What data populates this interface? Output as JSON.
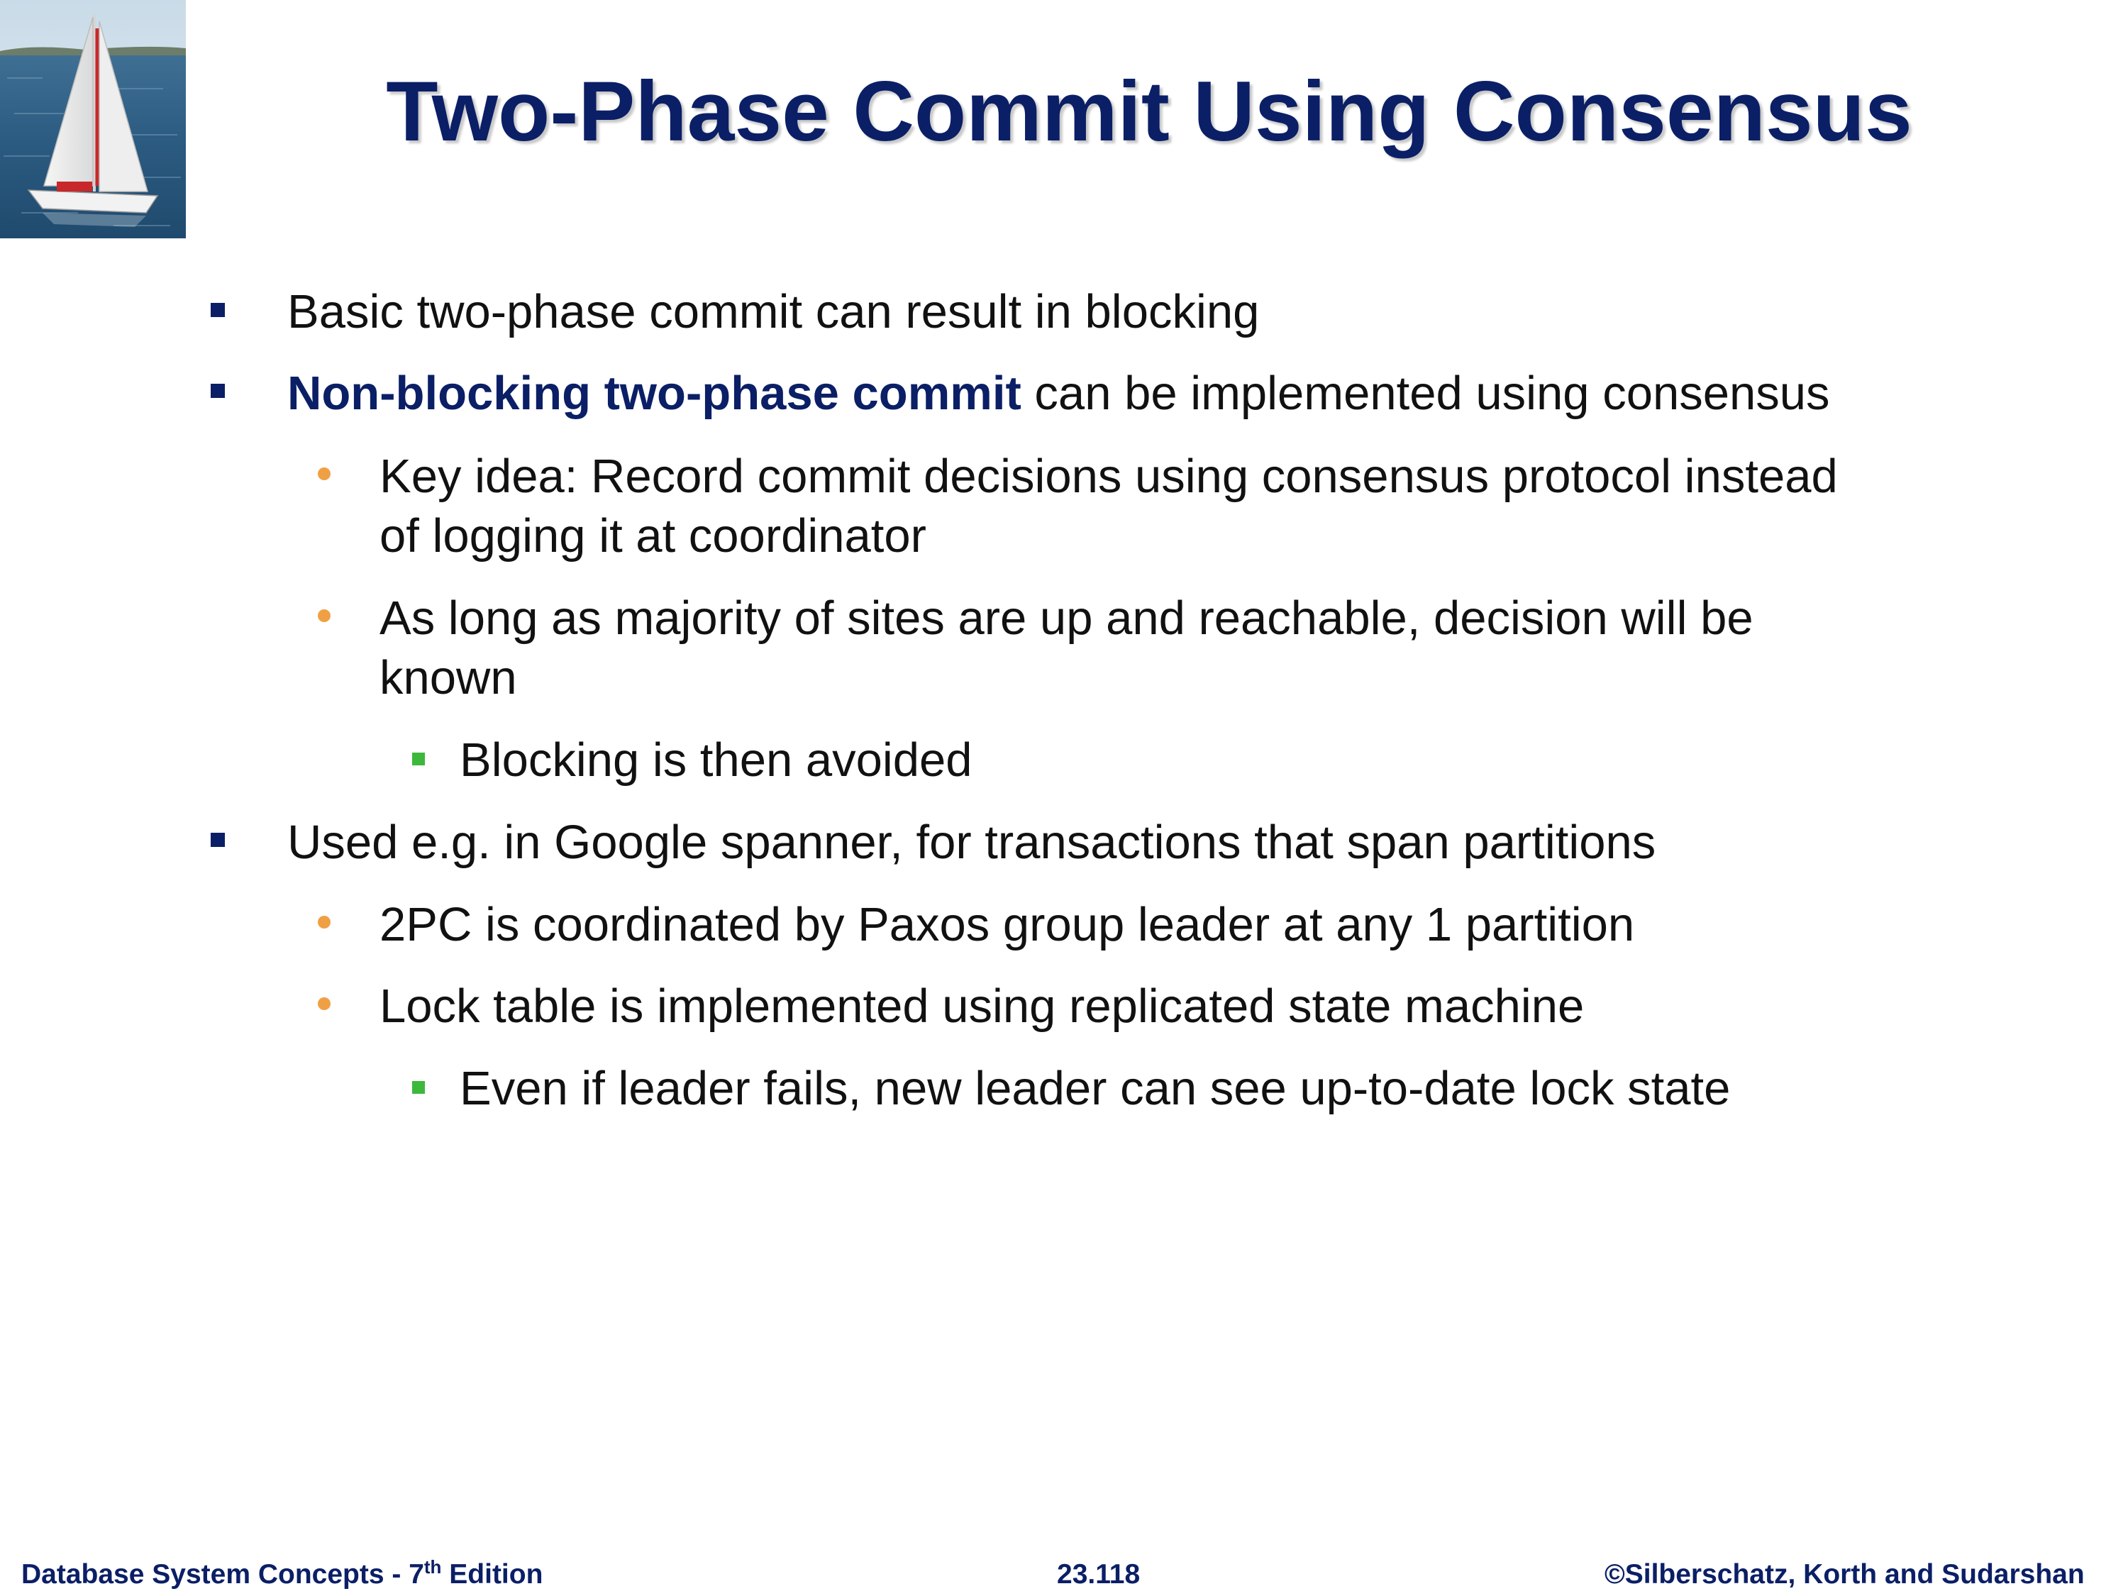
{
  "slide": {
    "title": "Two-Phase Commit Using Consensus",
    "bullets": [
      {
        "level": 1,
        "text": "Basic two-phase commit can result in blocking"
      },
      {
        "level": 1,
        "emphasis": "Non-blocking two-phase commit",
        "text": " can be implemented using consensus"
      },
      {
        "level": 2,
        "line1": "Key idea: Record commit decisions using consensus protocol instead",
        "line2": "of logging it at coordinator"
      },
      {
        "level": 2,
        "line1": "As long as majority of sites are up and reachable, decision will be",
        "line2": "known"
      },
      {
        "level": 3,
        "text": "Blocking is then avoided"
      },
      {
        "level": 1,
        "text": "Used e.g. in Google spanner, for transactions that span partitions"
      },
      {
        "level": 2,
        "text": "2PC is coordinated by Paxos group leader at any 1 partition"
      },
      {
        "level": 2,
        "text": "Lock table is implemented using replicated state machine"
      },
      {
        "level": 3,
        "text": "Even if leader fails, new leader can see up-to-date lock state"
      }
    ]
  },
  "footer": {
    "book_prefix": "Database System Concepts - 7",
    "book_sup": "th",
    "book_suffix": " Edition",
    "page_number": "23.118",
    "copyright": "©Silberschatz, Korth and Sudarshan"
  },
  "colors": {
    "title": "#0b1f66",
    "level1_bullet": "#0b1f66",
    "level2_bullet": "#f0a044",
    "level3_bullet": "#3cb83c",
    "emphasis": "#0b1f66"
  },
  "image": {
    "subject": "sailboat"
  }
}
